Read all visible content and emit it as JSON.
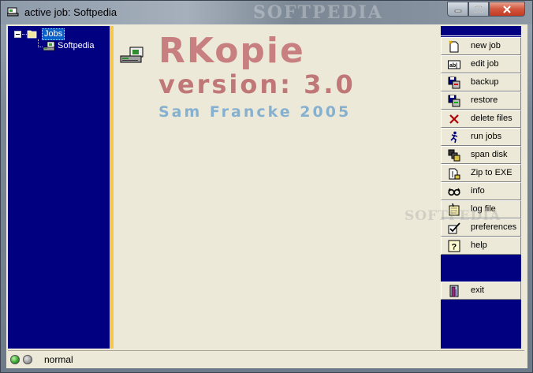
{
  "window": {
    "title": "active job: Softpedia",
    "watermark": "SOFTPEDIA"
  },
  "tree": {
    "root_label": "Jobs",
    "children": [
      "Softpedia"
    ]
  },
  "splash": {
    "app_name": "RKopie",
    "version": "version: 3.0",
    "author": "Sam Francke 2005"
  },
  "commands": [
    {
      "label": "new job",
      "icon": "new-document-icon"
    },
    {
      "label": "edit job",
      "icon": "edit-text-icon"
    },
    {
      "label": "backup",
      "icon": "backup-icon"
    },
    {
      "label": "restore",
      "icon": "restore-icon"
    },
    {
      "label": "delete files",
      "icon": "delete-x-icon"
    },
    {
      "label": "run jobs",
      "icon": "runner-icon"
    },
    {
      "label": "span disk",
      "icon": "span-disk-icon"
    },
    {
      "label": "Zip to EXE",
      "icon": "zip-icon"
    },
    {
      "label": "info",
      "icon": "glasses-icon"
    },
    {
      "label": "log file",
      "icon": "log-file-icon"
    },
    {
      "label": "preferences",
      "icon": "checkbox-pen-icon"
    },
    {
      "label": "help",
      "icon": "help-question-icon"
    },
    {
      "label": "exit",
      "icon": "exit-door-icon"
    }
  ],
  "status": {
    "text": "normal"
  },
  "colors": {
    "navy_panel": "#000080",
    "splitter": "#f6c84a",
    "app_name": "#c87f80",
    "author": "#86b0cf"
  }
}
